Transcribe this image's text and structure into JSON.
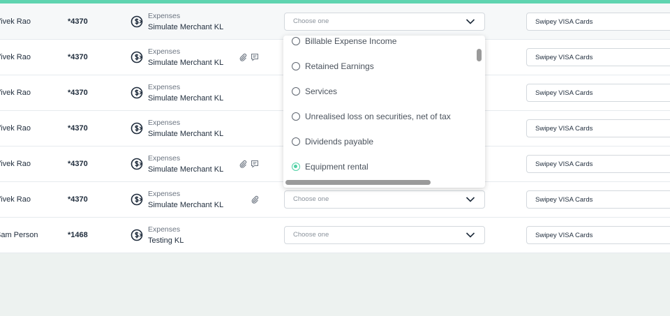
{
  "colors": {
    "accent": "#5fd4b0",
    "selected_radio": "#4fd1a5",
    "background": "#edf2f0"
  },
  "rows": [
    {
      "name": "Vivek Rao",
      "card": "*4370",
      "category": "Expenses",
      "merchant": "Simulate Merchant KL",
      "attachment": false,
      "comment": false,
      "select_placeholder": "Choose one",
      "account": "Swipey VISA Cards"
    },
    {
      "name": "Vivek Rao",
      "card": "*4370",
      "category": "Expenses",
      "merchant": "Simulate Merchant KL",
      "attachment": true,
      "comment": true,
      "select_placeholder": "",
      "account": "Swipey VISA Cards"
    },
    {
      "name": "Vivek Rao",
      "card": "*4370",
      "category": "Expenses",
      "merchant": "Simulate Merchant KL",
      "attachment": false,
      "comment": false,
      "select_placeholder": "",
      "account": "Swipey VISA Cards"
    },
    {
      "name": "Vivek Rao",
      "card": "*4370",
      "category": "Expenses",
      "merchant": "Simulate Merchant KL",
      "attachment": false,
      "comment": false,
      "select_placeholder": "",
      "account": "Swipey VISA Cards"
    },
    {
      "name": "Vivek Rao",
      "card": "*4370",
      "category": "Expenses",
      "merchant": "Simulate Merchant KL",
      "attachment": true,
      "comment": true,
      "select_placeholder": "",
      "account": "Swipey VISA Cards"
    },
    {
      "name": "Vivek Rao",
      "card": "*4370",
      "category": "Expenses",
      "merchant": "Simulate Merchant KL",
      "attachment": true,
      "comment": false,
      "select_placeholder": "Choose one",
      "account": "Swipey VISA Cards"
    },
    {
      "name": "Sam Person",
      "card": "*1468",
      "category": "Expenses",
      "merchant": "Testing KL",
      "attachment": false,
      "comment": false,
      "select_placeholder": "Choose one",
      "account": "Swipey VISA Cards"
    }
  ],
  "dropdown": {
    "options": [
      {
        "label": "Billable Expense Income",
        "selected": false
      },
      {
        "label": "Retained Earnings",
        "selected": false
      },
      {
        "label": "Services",
        "selected": false
      },
      {
        "label": "Unrealised loss on securities, net of tax",
        "selected": false
      },
      {
        "label": "Dividends payable",
        "selected": false
      },
      {
        "label": "Equipment rental",
        "selected": true
      }
    ]
  },
  "icons": {
    "expense": "currency-exchange-icon",
    "attachment": "paperclip-icon",
    "comment": "comment-icon",
    "chevron": "chevron-down-icon"
  }
}
